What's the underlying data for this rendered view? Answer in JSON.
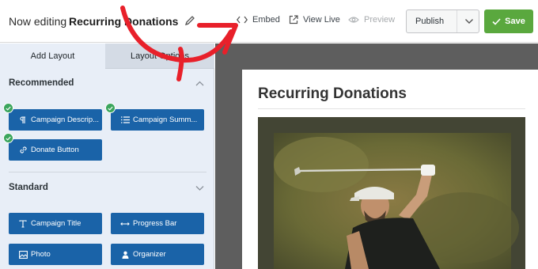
{
  "header": {
    "edit_prefix": "Now editing",
    "form_title": "Recurring Donations",
    "embed_label": "Embed",
    "view_live_label": "View Live",
    "preview_label": "Preview",
    "publish_label": "Publish",
    "save_label": "Save"
  },
  "sidebar": {
    "tabs": [
      {
        "label": "Add Layout",
        "active": true
      },
      {
        "label": "Layout Options",
        "active": false
      }
    ],
    "sections": [
      {
        "title": "Recommended",
        "blocks": [
          {
            "label": "Campaign Descrip...",
            "icon": "paragraph-icon",
            "checked": true
          },
          {
            "label": "Campaign Summ...",
            "icon": "list-icon",
            "checked": true
          },
          {
            "label": "Donate Button",
            "icon": "link-icon",
            "checked": true
          }
        ]
      },
      {
        "title": "Standard",
        "blocks": [
          {
            "label": "Campaign Title",
            "icon": "text-icon",
            "checked": false
          },
          {
            "label": "Progress Bar",
            "icon": "progress-icon",
            "checked": false
          },
          {
            "label": "Photo",
            "icon": "image-icon",
            "checked": false
          },
          {
            "label": "Organizer",
            "icon": "user-icon",
            "checked": false
          }
        ]
      }
    ]
  },
  "preview": {
    "title": "Recurring Donations",
    "image_alt": "golfer swinging a club"
  },
  "colors": {
    "block_blue": "#1a63a8",
    "save_green": "#5aa83e",
    "check_green": "#3ba55d",
    "annotation_red": "#e8202a"
  }
}
